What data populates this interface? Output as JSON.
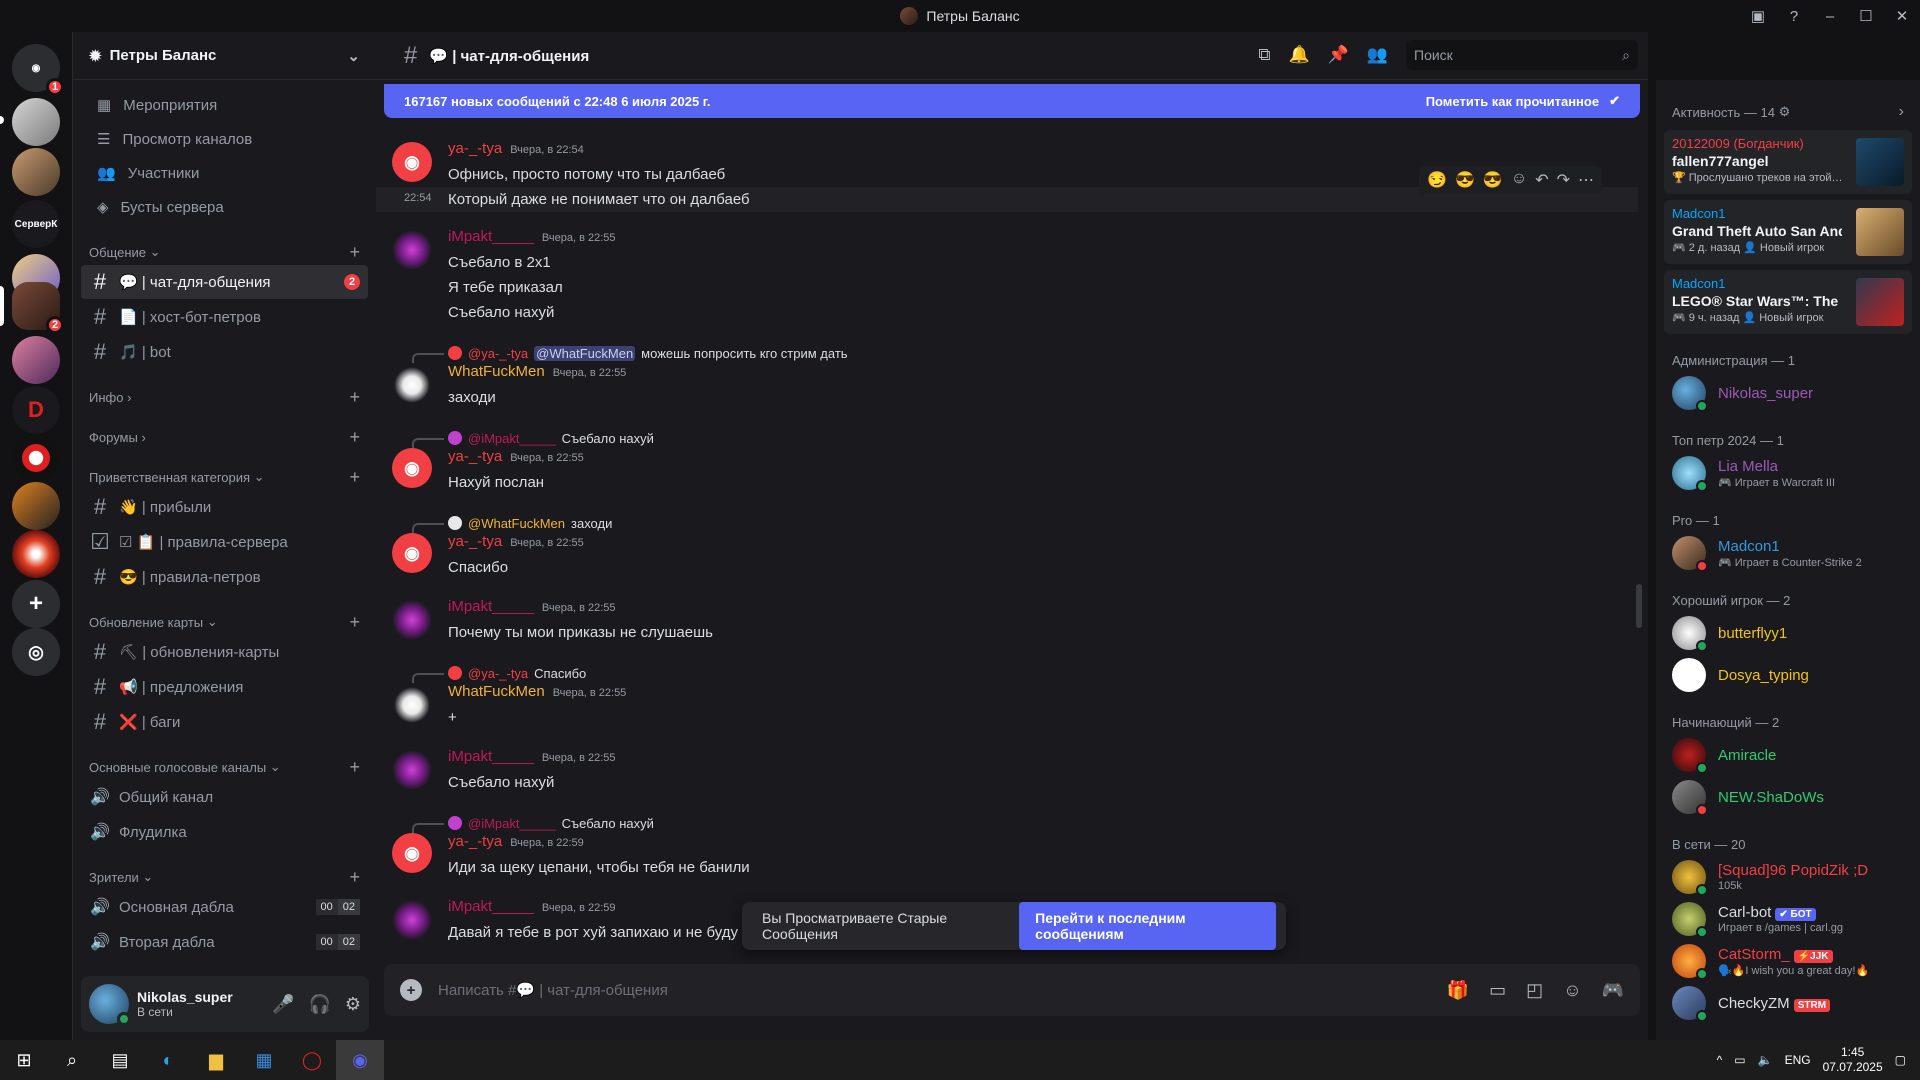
{
  "window": {
    "title": "Петры Баланс"
  },
  "server": {
    "name": "Петры Баланс",
    "guild_badge_main": "1",
    "guild_badge_2": "2",
    "guild_label": "СерверК"
  },
  "nav": [
    "Мероприятия",
    "Просмотр каналов",
    "Участники",
    "Бусты сервера"
  ],
  "categories": {
    "c1": "Общение",
    "c2": "Инфо",
    "c3": "Форумы",
    "c4": "Приветственная категория",
    "c5": "Обновление карты",
    "c6": "Основные голосовые каналы",
    "c7": "Зрители"
  },
  "channels": {
    "chat": "💬 | чат-для-общения",
    "chat_badge": "2",
    "host": "📄 | хост-бот-петров",
    "bot": "🎵 | bot",
    "prib": "👋 | прибыли",
    "rules": "☑ 📋 | правила-сервера",
    "rulesp": "😎 | правила-петров",
    "upd": "⛏ | обновления-карты",
    "pred": "📢 | предложения",
    "bugs": "❌ | баги",
    "v1": "Общий канал",
    "v2": "Флудилка",
    "v3": "Основная дабла",
    "v4": "Вторая дабла",
    "v3a": "00",
    "v3b": "02",
    "v4a": "00",
    "v4b": "02"
  },
  "user": {
    "name": "Nikolas_super",
    "status": "В сети"
  },
  "chat": {
    "title": "💬 | чат-для-общения",
    "search_placeholder": "Поиск",
    "new_messages": "167167 новых сообщений с 22:48 6 июля 2025 г.",
    "mark_read": "Пометить как прочитанное",
    "old_notice": "Вы Просматриваете Старые Сообщения",
    "jump": "Перейти к последним сообщениям",
    "composer_placeholder": "Написать #💬 | чат-для-общения"
  },
  "messages": {
    "m1_author": "ya-_-tya",
    "m1_time": "Вчера, в 22:54",
    "m1_text": "Офнись, просто потому что ты далбаеб",
    "m1b_time": "22:54",
    "m1b_text": "Который даже не понимает что он далбаеб",
    "m2_author": "iMpakt_____",
    "m2_time": "Вчера, в 22:55",
    "m2_t1": "Съебало в 2х1",
    "m2_t2": "Я тебе приказал",
    "m2_t3": "Съебало нахуй",
    "m3_reply_user": "@ya-_-tya",
    "m3_reply_mention": "@WhatFuckMen",
    "m3_reply_text": "можешь попросить кго стрим дать",
    "m3_author": "WhatFuckMen",
    "m3_time": "Вчера, в 22:55",
    "m3_text": "заходи",
    "m4_reply_user": "@iMpakt_____",
    "m4_reply_text": "Съебало нахуй",
    "m4_author": "ya-_-tya",
    "m4_time": "Вчера, в 22:55",
    "m4_text": "Нахуй послан",
    "m5_reply_user": "@WhatFuckMen",
    "m5_reply_text": "заходи",
    "m5_author": "ya-_-tya",
    "m5_time": "Вчера, в 22:55",
    "m5_text": "Спасибо",
    "m6_author": "iMpakt_____",
    "m6_time": "Вчера, в 22:55",
    "m6_text": "Почему ты мои приказы не слушаешь",
    "m7_reply_user": "@ya-_-tya",
    "m7_reply_text": "Спасибо",
    "m7_author": "WhatFuckMen",
    "m7_time": "Вчера, в 22:55",
    "m7_text": "+",
    "m8_author": "iMpakt_____",
    "m8_time": "Вчера, в 22:55",
    "m8_text": "Съебало нахуй",
    "m9_reply_user": "@iMpakt_____",
    "m9_reply_text": "Съебало нахуй",
    "m9_author": "ya-_-tya",
    "m9_time": "Вчера, в 22:59",
    "m9_text": "Иди за щеку цепани, чтобы тебя не банили",
    "m10_author": "iMpakt_____",
    "m10_time": "Вчера, в 22:59",
    "m10_text": "Давай я тебе в рот хуй запихаю и не буду"
  },
  "members": {
    "activity_title": "Активность — 14",
    "a1_name": "20122009 (Богданчик)",
    "a1_game": "fallen777angel",
    "a1_detail": "🏆 Прослушано треков на этой…",
    "a2_name": "Madcon1",
    "a2_game": "Grand Theft Auto San Andr…",
    "a2_detail": "🎮 2 д. назад  👤 Новый игрок",
    "a3_name": "Madcon1",
    "a3_game": "LEGO® Star Wars™: The Sk…",
    "a3_detail": "🎮 9 ч. назад  👤 Новый игрок",
    "admin_title": "Администрация — 1",
    "admin1": "Nikolas_super",
    "top_title": "Топ петр 2024 — 1",
    "top1": "Lia Mella",
    "top1_sub": "🎮 Играет в Warcraft III",
    "pro_title": "Pro — 1",
    "pro1": "Madcon1",
    "pro1_sub": "🎮 Играет в Counter-Strike 2",
    "good_title": "Хороший игрок — 2",
    "good1": "butterflyy1",
    "good2": "Dosya_typing",
    "beg_title": "Начинающий — 2",
    "beg1": "Amiracle",
    "beg2": "NEW.ShaDoWs",
    "online_title": "В сети — 20",
    "on1": "[Squad]96 PopidZik ;D",
    "on1_sub": "105k",
    "on2": "Carl-bot",
    "on2_tag": "✔ БОТ",
    "on2_sub": "Играет в /games | carl.gg",
    "on3": "CatStorm_",
    "on3_tag": "⚡JJK",
    "on3_sub": "🗣️🔥I wish you a great day!🔥",
    "on4": "CheckyZM",
    "on4_tag": "STRM"
  },
  "taskbar": {
    "lang": "ENG",
    "time": "1:45",
    "date": "07.07.2025"
  },
  "colors": {
    "accent": "#5865f2",
    "danger": "#f23f43",
    "online": "#23a55a"
  }
}
